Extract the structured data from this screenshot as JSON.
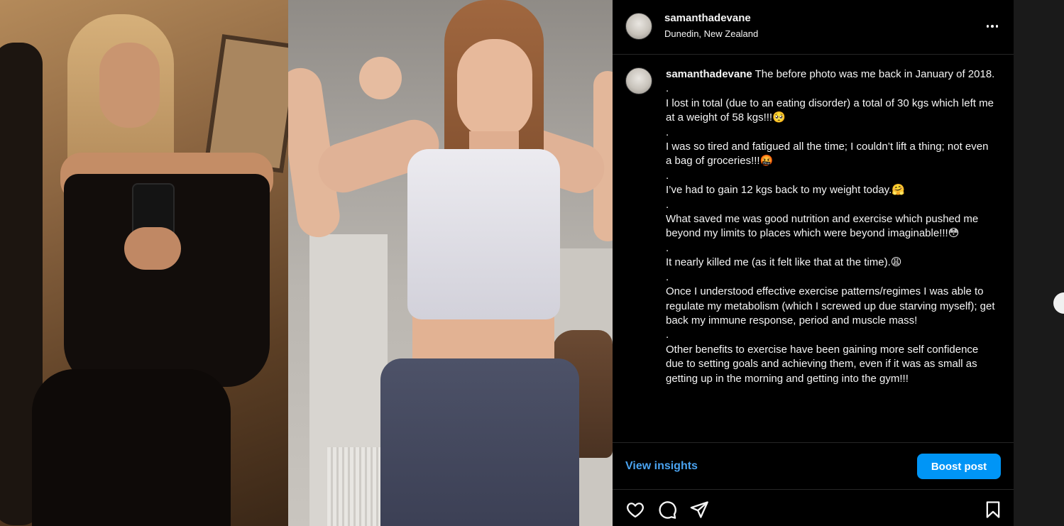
{
  "post": {
    "username": "samanthadevane",
    "location": "Dunedin, New Zealand",
    "caption_paragraphs": [
      "The before photo was me back in January of 2018.",
      ".",
      "I lost in total (due to an eating disorder) a total of 30 kgs which left me at a weight of 58 kgs!!!🥺",
      ".",
      "I was so tired and fatigued all the time; I couldn’t lift a thing; not even a bag of groceries!!!🤬",
      ".",
      "I’ve had to gain 12 kgs back to my weight today.🤗",
      ".",
      "What saved me was good nutrition and exercise which pushed me beyond my limits to places which were beyond imaginable!!!😳",
      ".",
      "It nearly killed me (as it felt like that at the time).😩",
      ".",
      "Once I understood effective exercise patterns/regimes I was able to regulate my metabolism (which I screwed up due starving myself); get back my immune response, period and muscle mass!",
      ".",
      "Other benefits to exercise have been gaining more self confidence due to setting goals and achieving them, even if it was as small as getting up in the morning and getting into the gym!!!"
    ]
  },
  "actions": {
    "view_insights": "View insights",
    "boost_post": "Boost post"
  },
  "icons": {
    "more": "more-options-icon",
    "like": "heart-icon",
    "comment": "comment-icon",
    "share": "share-icon",
    "save": "bookmark-icon",
    "next": "chevron-right-icon"
  },
  "colors": {
    "background": "#000000",
    "text": "#f5f5f5",
    "link": "#4aa3f0",
    "boost_button": "#0095f6",
    "divider": "#262626"
  }
}
